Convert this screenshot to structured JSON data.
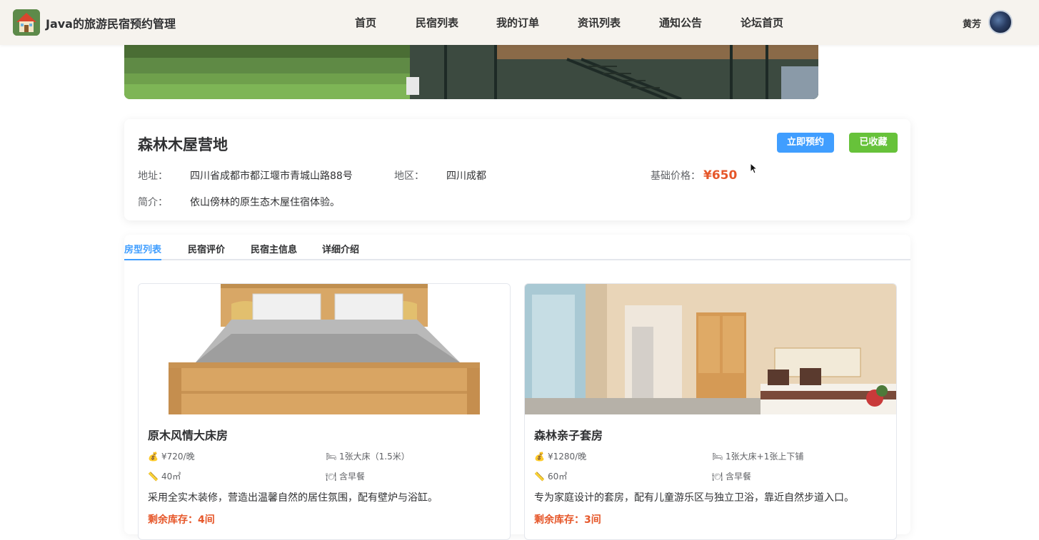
{
  "header": {
    "app_title": "Java的旅游民宿预约管理",
    "nav": [
      "首页",
      "民宿列表",
      "我的订单",
      "资讯列表",
      "通知公告",
      "论坛首页"
    ],
    "user_name": "黄芳"
  },
  "homestay": {
    "name": "森林木屋营地",
    "book_label": "立即预约",
    "fav_label": "已收藏",
    "address_label": "地址：",
    "address": "四川省成都市都江堰市青城山路88号",
    "region_label": "地区：",
    "region": "四川成都",
    "price_label": "基础价格：",
    "price": "¥650",
    "intro_label": "简介：",
    "intro": "依山傍林的原生态木屋住宿体验。"
  },
  "tabs": [
    "房型列表",
    "民宿评价",
    "民宿主信息",
    "详细介绍"
  ],
  "active_tab": "房型列表",
  "rooms": [
    {
      "name": "原木风情大床房",
      "price": "¥720/晚",
      "bed": "1张大床（1.5米）",
      "area": "40㎡",
      "breakfast": "含早餐",
      "desc": "采用全实木装修，营造出温馨自然的居住氛围，配有壁炉与浴缸。",
      "stock": "剩余库存：4间"
    },
    {
      "name": "森林亲子套房",
      "price": "¥1280/晚",
      "bed": "1张大床+1张上下铺",
      "area": "60㎡",
      "breakfast": "含早餐",
      "desc": "专为家庭设计的套房，配有儿童游乐区与独立卫浴，靠近自然步道入口。",
      "stock": "剩余库存：3间"
    }
  ],
  "icons": {
    "price": "money-bag-icon",
    "bed": "bed-icon",
    "area": "ruler-icon",
    "breakfast": "plate-icon"
  },
  "colors": {
    "primary": "#409eff",
    "success": "#67c23a",
    "price": "#e6572a",
    "header_bg": "#f6f3ee"
  }
}
